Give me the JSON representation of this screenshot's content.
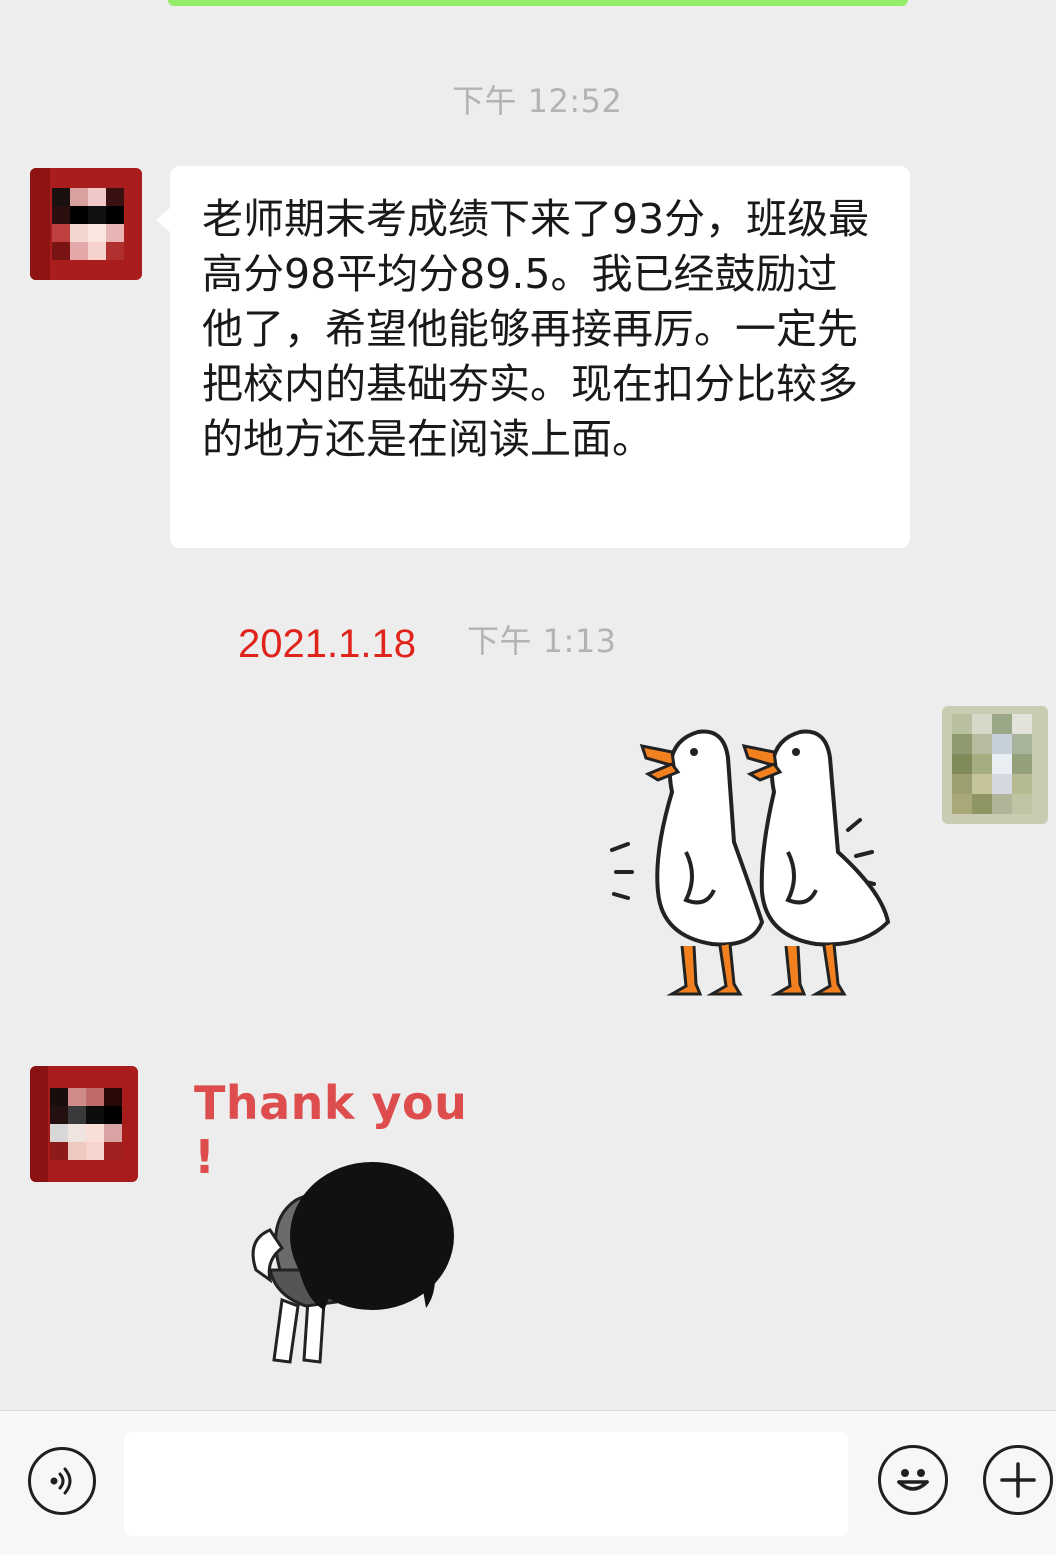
{
  "chat": {
    "messages": [
      {
        "type": "timestamp",
        "text": "下午 12:52"
      },
      {
        "type": "text",
        "side": "left",
        "text": "老师期末考成绩下来了93分，班级最高分98平均分89.5。我已经鼓励过他了，希望他能够再接再厉。一定先把校内的基础夯实。现在扣分比较多的地方还是在阅读上面。"
      },
      {
        "type": "timestamp",
        "text": "下午 1:13"
      },
      {
        "type": "sticker",
        "side": "right",
        "icon": "two-geese-sticker"
      },
      {
        "type": "sticker",
        "side": "left",
        "icon": "thank-you-bow-sticker",
        "caption": "Thank you !"
      }
    ],
    "annotation": "2021.1.18"
  },
  "input_bar": {
    "voice_icon": "voice-icon",
    "input_value": "",
    "emoji_icon": "emoji-icon",
    "plus_icon": "plus-icon"
  },
  "colors": {
    "background": "#ededed",
    "sent_bubble": "#95ec69",
    "received_bubble": "#ffffff",
    "timestamp": "#b3b3b3",
    "annotation": "#e0231b",
    "thanks_text": "#de4d4d"
  }
}
